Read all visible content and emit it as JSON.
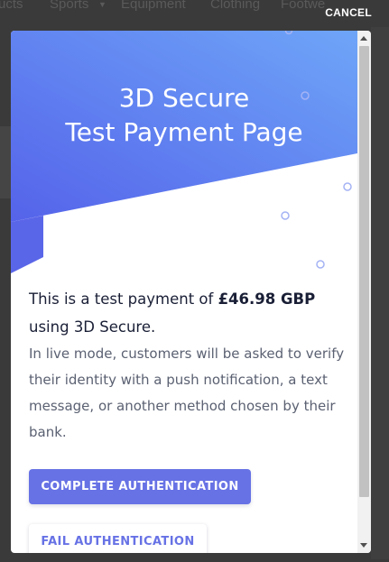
{
  "background_nav": {
    "items": [
      "ucts",
      "Sports",
      "Equipment",
      "Clothing",
      "Footwe"
    ]
  },
  "overlay": {
    "cancel_label": "CANCEL"
  },
  "hero": {
    "title_line1": "3D Secure",
    "title_line2": "Test Payment Page",
    "colors": {
      "gradient_start": "#6ea5f8",
      "gradient_end": "#5563ea"
    }
  },
  "message": {
    "lead_prefix": "This is a test payment of ",
    "amount": "£46.98 GBP",
    "lead_suffix": "using 3D Secure.",
    "detail": "In live mode, customers will be asked to verify their identity with a push notification, a text message, or another method chosen by their bank."
  },
  "actions": {
    "complete_label": "COMPLETE AUTHENTICATION",
    "fail_label": "FAIL AUTHENTICATION",
    "accent_color": "#6772e5"
  }
}
